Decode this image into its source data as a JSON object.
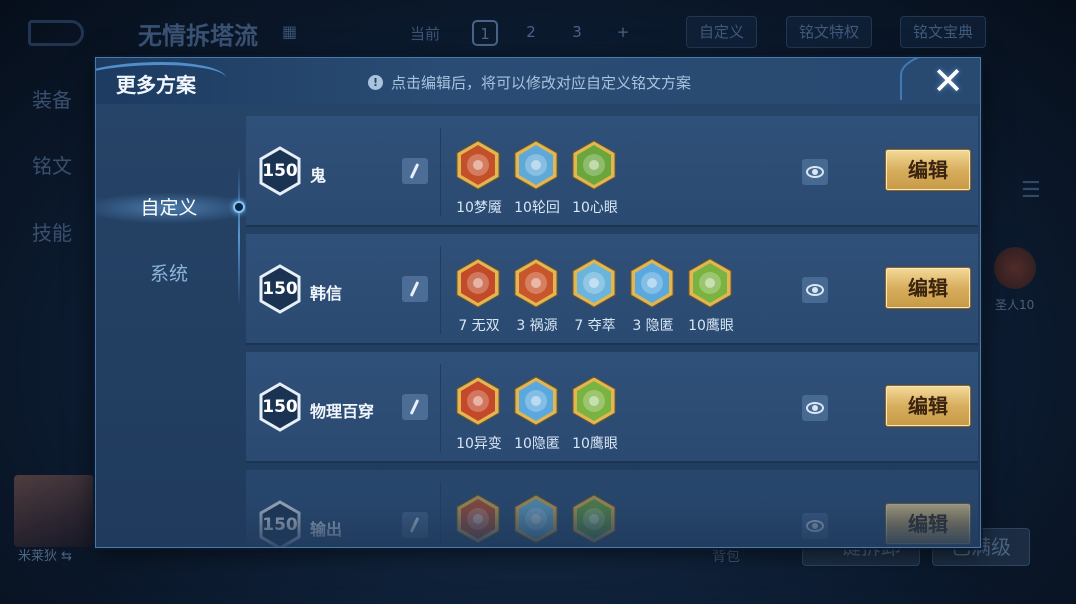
{
  "background": {
    "title": "无情拆塔流",
    "scheme_label": "当前",
    "scheme_tabs": [
      "1",
      "2",
      "3",
      "+"
    ],
    "custom_btn": "自定义",
    "rune_privilege_btn": "铭文特权",
    "rune_book_btn": "铭文宝典",
    "side_items": [
      "装备",
      "铭文",
      "技能"
    ],
    "hero_name": "米莱狄",
    "hero_swap": "⇆",
    "rune_right_label": "圣人10",
    "bag_label": "背包",
    "bottom_btn_1": "一键拆卸",
    "bottom_btn_2": "已满级"
  },
  "modal": {
    "title": "更多方案",
    "hint": "点击编辑后，将可以修改对应自定义铭文方案",
    "hint_icon": "!",
    "close_icon": "✕",
    "side_tabs": [
      {
        "label": "自定义"
      },
      {
        "label": "系统"
      }
    ],
    "edit_label": "编辑",
    "rows": [
      {
        "level": "150",
        "name": "鬼",
        "runes": [
          {
            "label": "10梦魇",
            "color": "#c4502a",
            "icon": "red-rune-icon"
          },
          {
            "label": "10轮回",
            "color": "#5fa9d8",
            "icon": "blue-rune-icon"
          },
          {
            "label": "10心眼",
            "color": "#6aa63b",
            "icon": "green-rune-icon"
          }
        ]
      },
      {
        "level": "150",
        "name": "韩信",
        "runes": [
          {
            "label": "7 无双",
            "color": "#c24a28",
            "icon": "red-rune-icon"
          },
          {
            "label": "3 祸源",
            "color": "#c8552c",
            "icon": "red-rune-icon"
          },
          {
            "label": "7 夺萃",
            "color": "#6bb4dc",
            "icon": "blue-rune-icon"
          },
          {
            "label": "3 隐匿",
            "color": "#5aa8de",
            "icon": "blue-rune-icon"
          },
          {
            "label": "10鹰眼",
            "color": "#7ab33f",
            "icon": "green-rune-icon"
          }
        ]
      },
      {
        "level": "150",
        "name": "物理百穿",
        "runes": [
          {
            "label": "10异变",
            "color": "#c4482a",
            "icon": "red-rune-icon"
          },
          {
            "label": "10隐匿",
            "color": "#5aa8de",
            "icon": "blue-rune-icon"
          },
          {
            "label": "10鹰眼",
            "color": "#7ab33f",
            "icon": "green-rune-icon"
          }
        ]
      },
      {
        "level": "150",
        "name": "输出",
        "runes": [
          {
            "label": "",
            "color": "#c4502a",
            "icon": "red-rune-icon"
          },
          {
            "label": "",
            "color": "#6bb4dc",
            "icon": "blue-rune-icon"
          },
          {
            "label": "",
            "color": "#6aa63b",
            "icon": "green-rune-icon"
          }
        ]
      }
    ]
  },
  "colors": {
    "accent_gold": "#d7ae5e",
    "panel": "#274569",
    "glow": "#7ec6ff"
  }
}
